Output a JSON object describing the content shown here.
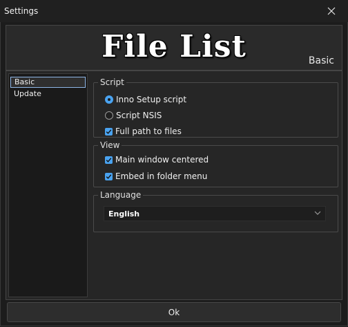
{
  "window": {
    "title": "Settings"
  },
  "header": {
    "logo_text": "File List",
    "page_name": "Basic"
  },
  "sidebar": {
    "items": [
      {
        "label": "Basic",
        "selected": true
      },
      {
        "label": "Update",
        "selected": false
      }
    ]
  },
  "script_group": {
    "legend": "Script",
    "options": [
      {
        "label": "Inno Setup script",
        "checked": true
      },
      {
        "label": "Script NSIS",
        "checked": false
      }
    ],
    "full_path": {
      "label": "Full path to files",
      "checked": true
    }
  },
  "view_group": {
    "legend": "View",
    "options": [
      {
        "label": "Main window centered",
        "checked": true
      },
      {
        "label": "Embed in folder menu",
        "checked": true
      }
    ]
  },
  "language_group": {
    "legend": "Language",
    "selected": "English"
  },
  "footer": {
    "ok_label": "Ok"
  },
  "colors": {
    "accent": "#4aa3f0",
    "background": "#1c1c1c",
    "panel": "#262626"
  }
}
